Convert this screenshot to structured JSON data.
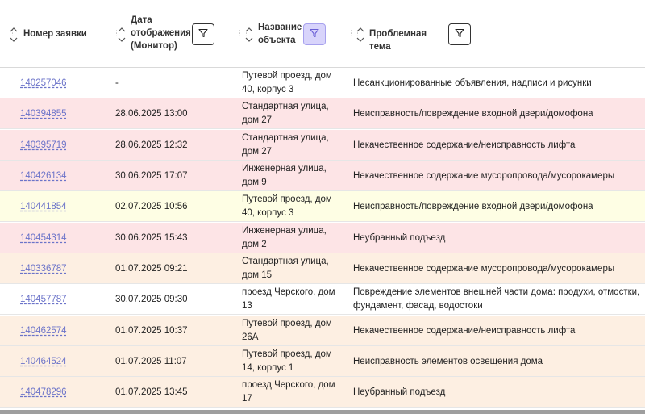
{
  "columns": [
    {
      "label": "Номер заявки",
      "lines": [
        "Номер заявки"
      ],
      "has_filter": false
    },
    {
      "label": "Дата отображения (Монитор)",
      "lines": [
        "Дата",
        "отображения",
        "(Монитор)"
      ],
      "has_filter": true,
      "filter_active": false
    },
    {
      "label": "Название объекта",
      "lines": [
        "Название",
        "объекта"
      ],
      "has_filter": true,
      "filter_active": true
    },
    {
      "label": "Проблемная тема",
      "lines": [
        "Проблемная тема"
      ],
      "has_filter": true,
      "filter_active": false
    }
  ],
  "colors": {
    "pink": "#fde4e6",
    "yellow": "#fefee4",
    "peach": "#fdefe2",
    "white": "#ffffff",
    "link": "#6b73c9",
    "filter_active": "#d8d4fb"
  },
  "rows": [
    {
      "number": "140257046",
      "date": "-",
      "object": "Путевой проезд, дом 40, корпус 3",
      "topic": "Несанкционированные объявления, надписи и рисунки",
      "color": "white"
    },
    {
      "number": "140394855",
      "date": "28.06.2025 13:00",
      "object": "Стандартная улица, дом 27",
      "topic": "Неисправность/повреждение входной двери/домофона",
      "color": "pink"
    },
    {
      "number": "140395719",
      "date": "28.06.2025 12:32",
      "object": "Стандартная улица, дом 27",
      "topic": "Некачественное содержание/неисправность лифта",
      "color": "pink"
    },
    {
      "number": "140426134",
      "date": "30.06.2025 17:07",
      "object": "Инженерная улица, дом 9",
      "topic": "Некачественное содержание мусоропровода/мусорокамеры",
      "color": "pink"
    },
    {
      "number": "140441854",
      "date": "02.07.2025 10:56",
      "object": "Путевой проезд, дом 40, корпус 3",
      "topic": "Неисправность/повреждение входной двери/домофона",
      "color": "yellow"
    },
    {
      "number": "140454314",
      "date": "30.06.2025 15:43",
      "object": "Инженерная улица, дом 2",
      "topic": "Неубранный подъезд",
      "color": "pink"
    },
    {
      "number": "140336787",
      "date": "01.07.2025 09:21",
      "object": "Стандартная улица, дом 15",
      "topic": "Некачественное содержание мусоропровода/мусорокамеры",
      "color": "peach"
    },
    {
      "number": "140457787",
      "date": "30.07.2025 09:30",
      "object": "проезд Черского, дом 13",
      "topic": "Повреждение элементов внешней части дома: продухи, отмостки, фундамент, фасад, водостоки",
      "color": "white"
    },
    {
      "number": "140462574",
      "date": "01.07.2025 10:37",
      "object": "Путевой проезд, дом 26А",
      "topic": "Некачественное содержание/неисправность лифта",
      "color": "peach"
    },
    {
      "number": "140464524",
      "date": "01.07.2025 11:07",
      "object": "Путевой проезд, дом 14, корпус 1",
      "topic": "Неисправность элементов освещения дома",
      "color": "peach"
    },
    {
      "number": "140478296",
      "date": "01.07.2025 13:45",
      "object": "проезд Черского, дом 17",
      "topic": "Неубранный подъезд",
      "color": "peach"
    }
  ]
}
